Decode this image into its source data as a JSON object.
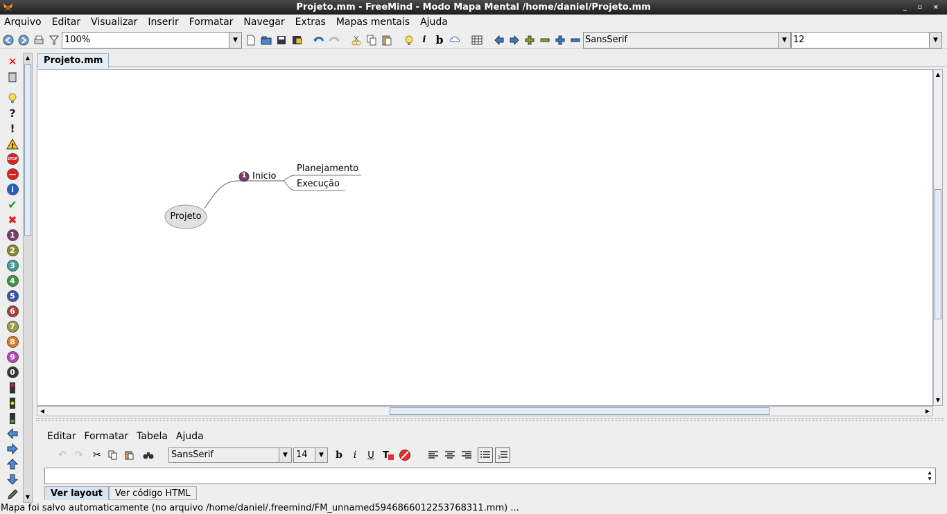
{
  "window": {
    "title": "Projeto.mm - FreeMind - Modo Mapa Mental /home/daniel/Projeto.mm",
    "controls": "_ ▫ ×"
  },
  "menu": [
    "Arquivo",
    "Editar",
    "Visualizar",
    "Inserir",
    "Formatar",
    "Navegar",
    "Extras",
    "Mapas mentais",
    "Ajuda"
  ],
  "toolbar": {
    "zoom": "100%",
    "font": "SansSerif",
    "font_size": "12"
  },
  "tab": {
    "label": "Projeto.mm"
  },
  "map": {
    "root": "Projeto",
    "child": "Inicio",
    "child_icon_number": "1",
    "grandchildren": [
      "Planejamento",
      "Execução"
    ]
  },
  "editor": {
    "menu": [
      "Editar",
      "Formatar",
      "Tabela",
      "Ajuda"
    ],
    "font": "SansSerif",
    "font_size": "14",
    "bold": "b",
    "italic": "i",
    "underline": "U",
    "tabs": [
      "Ver layout",
      "Ver código HTML"
    ]
  },
  "status": "Mapa foi salvo automaticamente (no arquivo /home/daniel/.freemind/FM_unnamed5946866012253768311.mm) ...",
  "colors": {
    "accent": "#3c7ec4",
    "node_fill": "#e0e0e0",
    "edge": "#7a7a7a"
  }
}
